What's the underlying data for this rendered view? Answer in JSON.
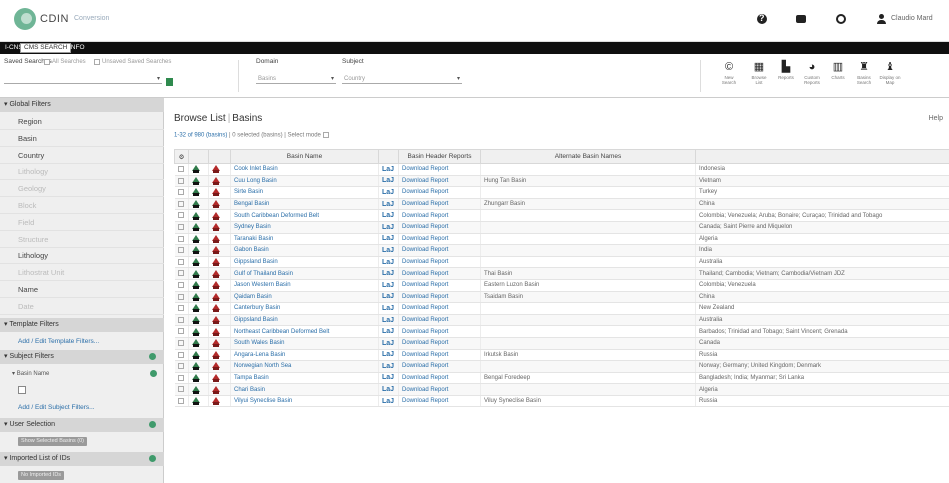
{
  "header": {
    "logo_text": "CDIN",
    "logo_sub": "Conversion",
    "user_name": "Claudio Mard"
  },
  "tabs": [
    {
      "label": "I-CNS"
    },
    {
      "label": "CMS SEARCH"
    },
    {
      "label": "INFO"
    }
  ],
  "toolbar": {
    "saved_searches_label": "Saved Searches",
    "all_searches": "All Searches",
    "unsaved_searches": "Unsaved Saved Searches",
    "domain_label": "Domain",
    "domain_value": "Basins",
    "subject_label": "Subject",
    "subject_value": "Country",
    "tools": [
      {
        "icon": "copyright-icon",
        "glyph": "©",
        "label": "New Search"
      },
      {
        "icon": "table-icon",
        "glyph": "▦",
        "label": "Browse List"
      },
      {
        "icon": "reports-icon",
        "glyph": "▙",
        "label": "Reports"
      },
      {
        "icon": "dashboard-icon",
        "glyph": "◕",
        "label": "Custom Reports"
      },
      {
        "icon": "bar-chart-icon",
        "glyph": "▥",
        "label": "Charts"
      },
      {
        "icon": "tree-icon",
        "glyph": "♜",
        "label": "Basins Search"
      },
      {
        "icon": "export-icon",
        "glyph": "♝",
        "label": "Display on Map"
      }
    ]
  },
  "sidebar": {
    "global_filters": "Global Filters",
    "items": [
      {
        "label": "Region",
        "dim": false
      },
      {
        "label": "Basin",
        "dim": false
      },
      {
        "label": "Country",
        "dim": false
      },
      {
        "label": "Lithology",
        "dim": true
      },
      {
        "label": "Geology",
        "dim": true
      },
      {
        "label": "Block",
        "dim": true
      },
      {
        "label": "Field",
        "dim": true
      },
      {
        "label": "Structure",
        "dim": true
      },
      {
        "label": "Lithology",
        "dim": false
      },
      {
        "label": "Lithostrat Unit",
        "dim": true
      },
      {
        "label": "Name",
        "dim": false
      },
      {
        "label": "Date",
        "dim": true
      }
    ],
    "template_filters": "Template Filters",
    "add_template_filters": "Add / Edit Template Filters...",
    "subject_filters": "Subject Filters",
    "basin_name": "Basin Name",
    "add_subject_filters": "Add / Edit Subject Filters...",
    "user_selection": "User Selection",
    "user_selection_chip": "Show Selected Basins (0)",
    "imported_list": "Imported List of IDs",
    "imported_chip": "No Imported IDs"
  },
  "main": {
    "title": "Browse List",
    "title_suffix": "Basins",
    "help": "Help",
    "summary": "1-32 of 980 (basins)",
    "summary_mid": "0 selected (basins)",
    "select_mode": "Select mode",
    "columns": [
      "Basin Name",
      "Basin Header Reports",
      "Alternate Basin Names",
      ""
    ]
  },
  "rows": [
    {
      "name": "Cook Inlet Basin",
      "report": "Download Report",
      "alt": "",
      "country": "Indonesia"
    },
    {
      "name": "Cuu Long Basin",
      "report": "Download Report",
      "alt": "Hung Tan Basin",
      "country": "Vietnam"
    },
    {
      "name": "Sirte Basin",
      "report": "Download Report",
      "alt": "",
      "country": "Turkey"
    },
    {
      "name": "Bengal Basin",
      "report": "Download Report",
      "alt": "Zhungarr Basin",
      "country": "China"
    },
    {
      "name": "South Caribbean Deformed Belt",
      "report": "Download Report",
      "alt": "",
      "country": "Colombia; Venezuela; Aruba; Bonaire; Curaçao; Trinidad and Tobago"
    },
    {
      "name": "Sydney Basin",
      "report": "Download Report",
      "alt": "",
      "country": "Canada; Saint Pierre and Miquelon"
    },
    {
      "name": "Taranaki Basin",
      "report": "Download Report",
      "alt": "",
      "country": "Algeria"
    },
    {
      "name": "Gabon Basin",
      "report": "Download Report",
      "alt": "",
      "country": "India"
    },
    {
      "name": "Gippsland Basin",
      "report": "Download Report",
      "alt": "",
      "country": "Australia"
    },
    {
      "name": "Gulf of Thailand Basin",
      "report": "Download Report",
      "alt": "Thai Basin",
      "country": "Thailand; Cambodia; Vietnam; Cambodia/Vietnam JDZ"
    },
    {
      "name": "Jason Western Basin",
      "report": "Download Report",
      "alt": "Eastern Luzon Basin",
      "country": "Colombia; Venezuela"
    },
    {
      "name": "Qaidam Basin",
      "report": "Download Report",
      "alt": "Tsaidam Basin",
      "country": "China"
    },
    {
      "name": "Canterbury Basin",
      "report": "Download Report",
      "alt": "",
      "country": "New Zealand"
    },
    {
      "name": "Gippsland Basin",
      "report": "Download Report",
      "alt": "",
      "country": "Australia"
    },
    {
      "name": "Northeast Caribbean Deformed Belt",
      "report": "Download Report",
      "alt": "",
      "country": "Barbados; Trinidad and Tobago; Saint Vincent; Grenada"
    },
    {
      "name": "South Wales Basin",
      "report": "Download Report",
      "alt": "",
      "country": "Canada"
    },
    {
      "name": "Angara-Lena Basin",
      "report": "Download Report",
      "alt": "Irkutsk Basin",
      "country": "Russia"
    },
    {
      "name": "Norwegian North Sea",
      "report": "Download Report",
      "alt": "",
      "country": "Norway; Germany; United Kingdom; Denmark"
    },
    {
      "name": "Tampa Basin",
      "report": "Download Report",
      "alt": "Bengal Foredeep",
      "country": "Bangladesh; India; Myanmar; Sri Lanka"
    },
    {
      "name": "Chari Basin",
      "report": "Download Report",
      "alt": "",
      "country": "Algeria"
    },
    {
      "name": "Vilyui Syneclise Basin",
      "report": "Download Report",
      "alt": "Viluy Syneclise Basin",
      "country": "Russia"
    }
  ]
}
